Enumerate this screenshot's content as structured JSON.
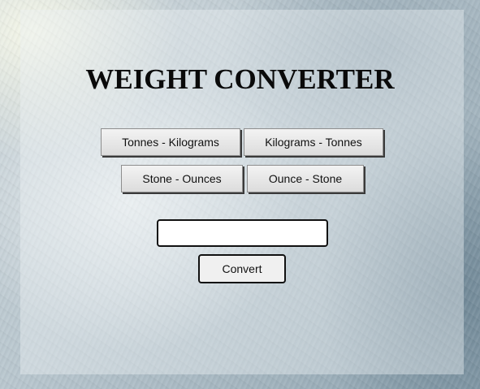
{
  "page": {
    "title": "WEIGHT CONVERTER"
  },
  "conversion_buttons": [
    {
      "label": "Tonnes - Kilograms"
    },
    {
      "label": "Kilograms - Tonnes"
    },
    {
      "label": "Stone - Ounces"
    },
    {
      "label": "Ounce - Stone"
    }
  ],
  "input": {
    "value": "",
    "placeholder": ""
  },
  "convert_button": {
    "label": "Convert"
  }
}
